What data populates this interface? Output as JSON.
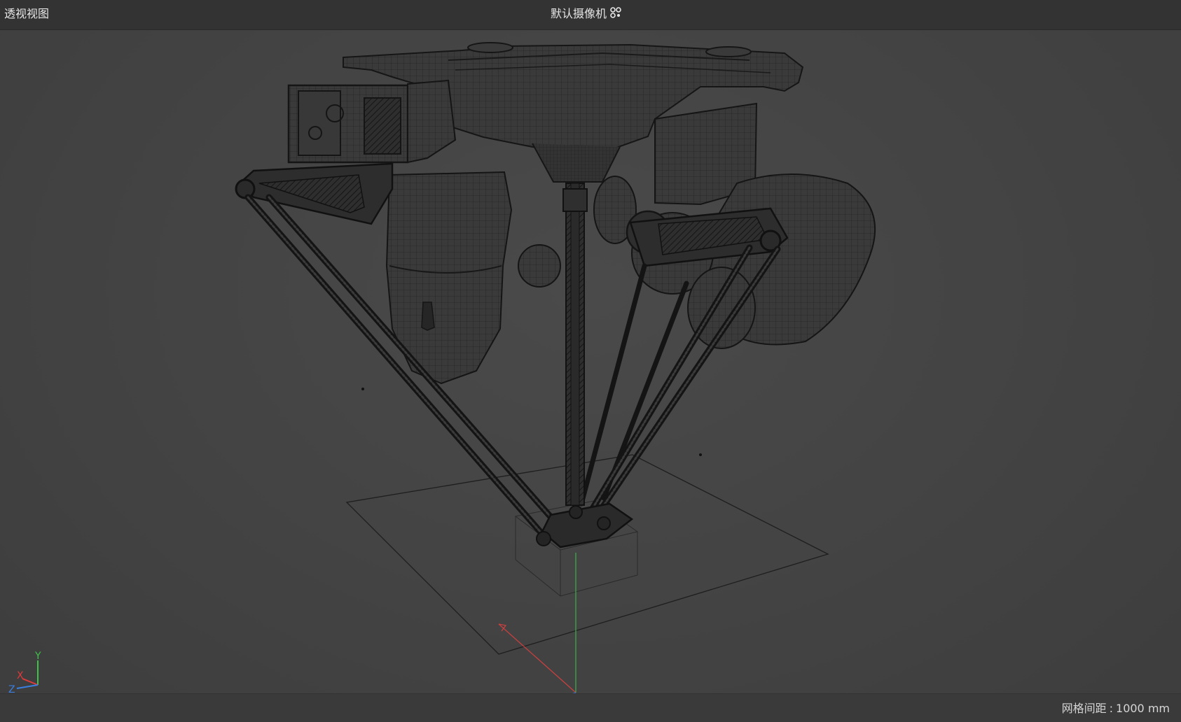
{
  "viewport": {
    "view_name": "透视视图",
    "camera_label": "默认摄像机",
    "camera_icon": "camera-dots-icon"
  },
  "status": {
    "grid_label": "网格间距",
    "grid_separator": ":",
    "grid_value": "1000 mm"
  },
  "axis_gizmo": {
    "y": "Y",
    "x": "X",
    "z": "Z"
  },
  "colors": {
    "background": "#444444",
    "topbar": "#333333",
    "axis_x": "#e03a3a",
    "axis_y": "#3fc24a",
    "axis_z": "#3a7ee0",
    "wireframe": "#1c1c1c"
  }
}
